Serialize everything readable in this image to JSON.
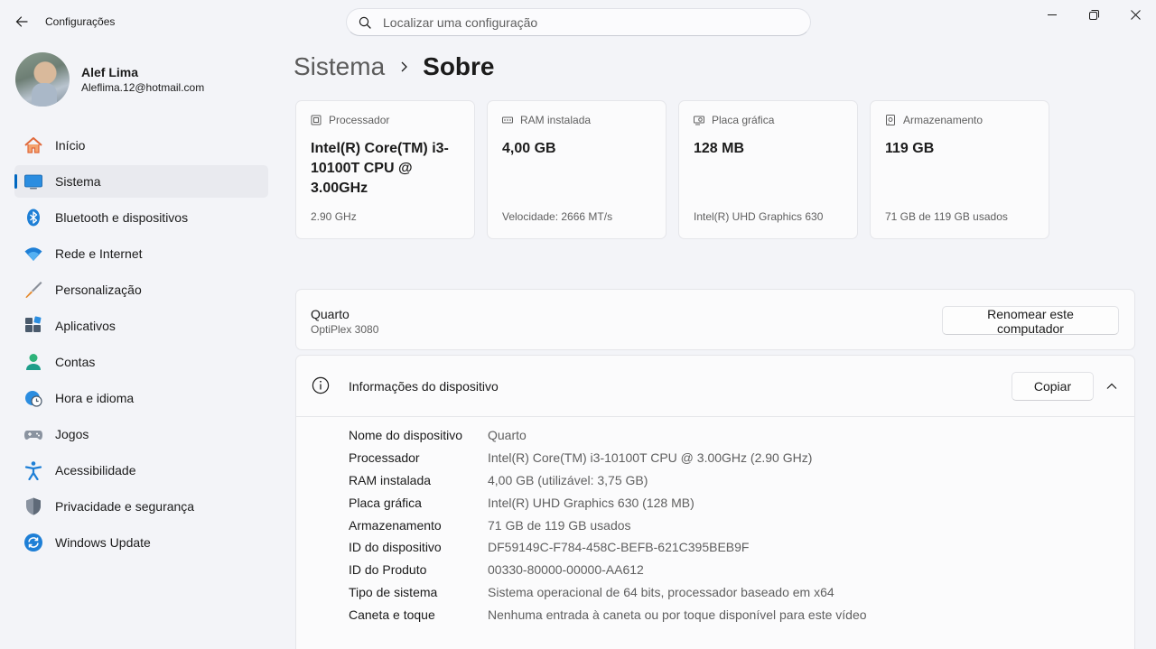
{
  "titlebar": {
    "app_title": "Configurações",
    "search_placeholder": "Localizar uma configuração"
  },
  "profile": {
    "name": "Alef Lima",
    "email": "Aleflima.12@hotmail.com"
  },
  "sidebar": {
    "items": [
      {
        "label": "Início",
        "icon": "home-icon"
      },
      {
        "label": "Sistema",
        "icon": "system-icon",
        "active": true
      },
      {
        "label": "Bluetooth e dispositivos",
        "icon": "bluetooth-icon"
      },
      {
        "label": "Rede e Internet",
        "icon": "wifi-icon"
      },
      {
        "label": "Personalização",
        "icon": "brush-icon"
      },
      {
        "label": "Aplicativos",
        "icon": "apps-icon"
      },
      {
        "label": "Contas",
        "icon": "account-icon"
      },
      {
        "label": "Hora e idioma",
        "icon": "clock-globe-icon"
      },
      {
        "label": "Jogos",
        "icon": "gamepad-icon"
      },
      {
        "label": "Acessibilidade",
        "icon": "accessibility-icon"
      },
      {
        "label": "Privacidade e segurança",
        "icon": "shield-icon"
      },
      {
        "label": "Windows Update",
        "icon": "update-icon"
      }
    ]
  },
  "breadcrumb": {
    "parent": "Sistema",
    "current": "Sobre"
  },
  "cards": [
    {
      "title": "Processador",
      "value": "Intel(R) Core(TM) i3-10100T CPU @ 3.00GHz",
      "sub": "2.90 GHz",
      "icon": "processor-icon"
    },
    {
      "title": "RAM instalada",
      "value": "4,00 GB",
      "sub": "Velocidade: 2666 MT/s",
      "icon": "ram-icon"
    },
    {
      "title": "Placa gráfica",
      "value": "128 MB",
      "sub": "Intel(R) UHD Graphics 630",
      "icon": "gpu-icon"
    },
    {
      "title": "Armazenamento",
      "value": "119 GB",
      "sub": "71 GB de 119 GB usados",
      "icon": "storage-icon"
    }
  ],
  "rename": {
    "device_name": "Quarto",
    "model": "OptiPlex 3080",
    "button": "Renomear este computador"
  },
  "device_info": {
    "title": "Informações do dispositivo",
    "copy_button": "Copiar",
    "rows": [
      {
        "key": "Nome do dispositivo",
        "value": "Quarto"
      },
      {
        "key": "Processador",
        "value": "Intel(R) Core(TM) i3-10100T CPU @ 3.00GHz (2.90 GHz)"
      },
      {
        "key": "RAM instalada",
        "value": "4,00 GB (utilizável: 3,75 GB)"
      },
      {
        "key": "Placa gráfica",
        "value": "Intel(R) UHD Graphics 630 (128 MB)"
      },
      {
        "key": "Armazenamento",
        "value": "71 GB de 119 GB usados"
      },
      {
        "key": "ID do dispositivo",
        "value": "DF59149C-F784-458C-BEFB-621C395BEB9F"
      },
      {
        "key": "ID do Produto",
        "value": "00330-80000-00000-AA612"
      },
      {
        "key": "Tipo de sistema",
        "value": "Sistema operacional de 64 bits, processador baseado em x64"
      },
      {
        "key": "Caneta e toque",
        "value": "Nenhuma entrada à caneta ou por toque disponível para este vídeo"
      }
    ]
  },
  "colors": {
    "accent": "#0067c0",
    "background": "#f3f4f8"
  }
}
